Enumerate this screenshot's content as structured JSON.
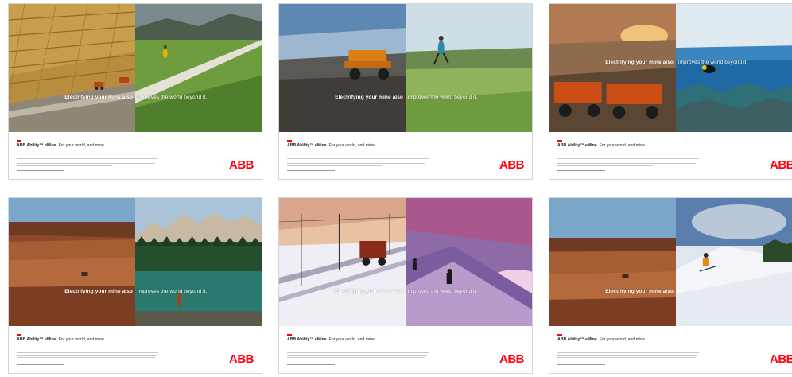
{
  "ads": [
    {
      "tag_left": "Electrifying your mine also",
      "tag_right": "improves the world beyond it.",
      "headline_bold": "ABB Ability™ eMine.",
      "headline_rest": " For your world, and mine.",
      "logo": "ABB",
      "left_scene": "open-pit-mine-truck",
      "right_scene": "boardwalk-runner"
    },
    {
      "tag_left": "Electrifying your mine also",
      "tag_right": "improves the world beyond it.",
      "headline_bold": "ABB Ability™ eMine.",
      "headline_rest": " For your world, and mine.",
      "logo": "ABB",
      "left_scene": "haul-truck",
      "right_scene": "trail-runner"
    },
    {
      "tag_left": "Electrifying your mine also",
      "tag_right": "improves the world beyond it.",
      "headline_bold": "ABB Ability™ eMine.",
      "headline_rest": " For your world, and mine.",
      "logo": "ABB",
      "left_scene": "haul-trucks-sunset",
      "right_scene": "scuba-diver-reef"
    },
    {
      "tag_left": "Electrifying your mine also",
      "tag_right": "improves the world beyond it.",
      "headline_bold": "ABB Ability™ eMine.",
      "headline_rest": " For your world, and mine.",
      "logo": "ABB",
      "left_scene": "red-earth-mine",
      "right_scene": "mountain-lake"
    },
    {
      "tag_left": "Electrifying your mine also",
      "tag_right": "improves the world beyond it.",
      "headline_bold": "ABB Ability™ eMine.",
      "headline_rest": " For your world, and mine.",
      "logo": "ABB",
      "left_scene": "snowy-trolley-truck",
      "right_scene": "alpine-climbers"
    },
    {
      "tag_left": "Electrifying your mine also",
      "tag_right": "",
      "headline_bold": "ABB Ability™ eMine.",
      "headline_rest": " For your world, and mine.",
      "logo": "ABB",
      "left_scene": "red-earth-mine",
      "right_scene": "skier-slope"
    }
  ]
}
